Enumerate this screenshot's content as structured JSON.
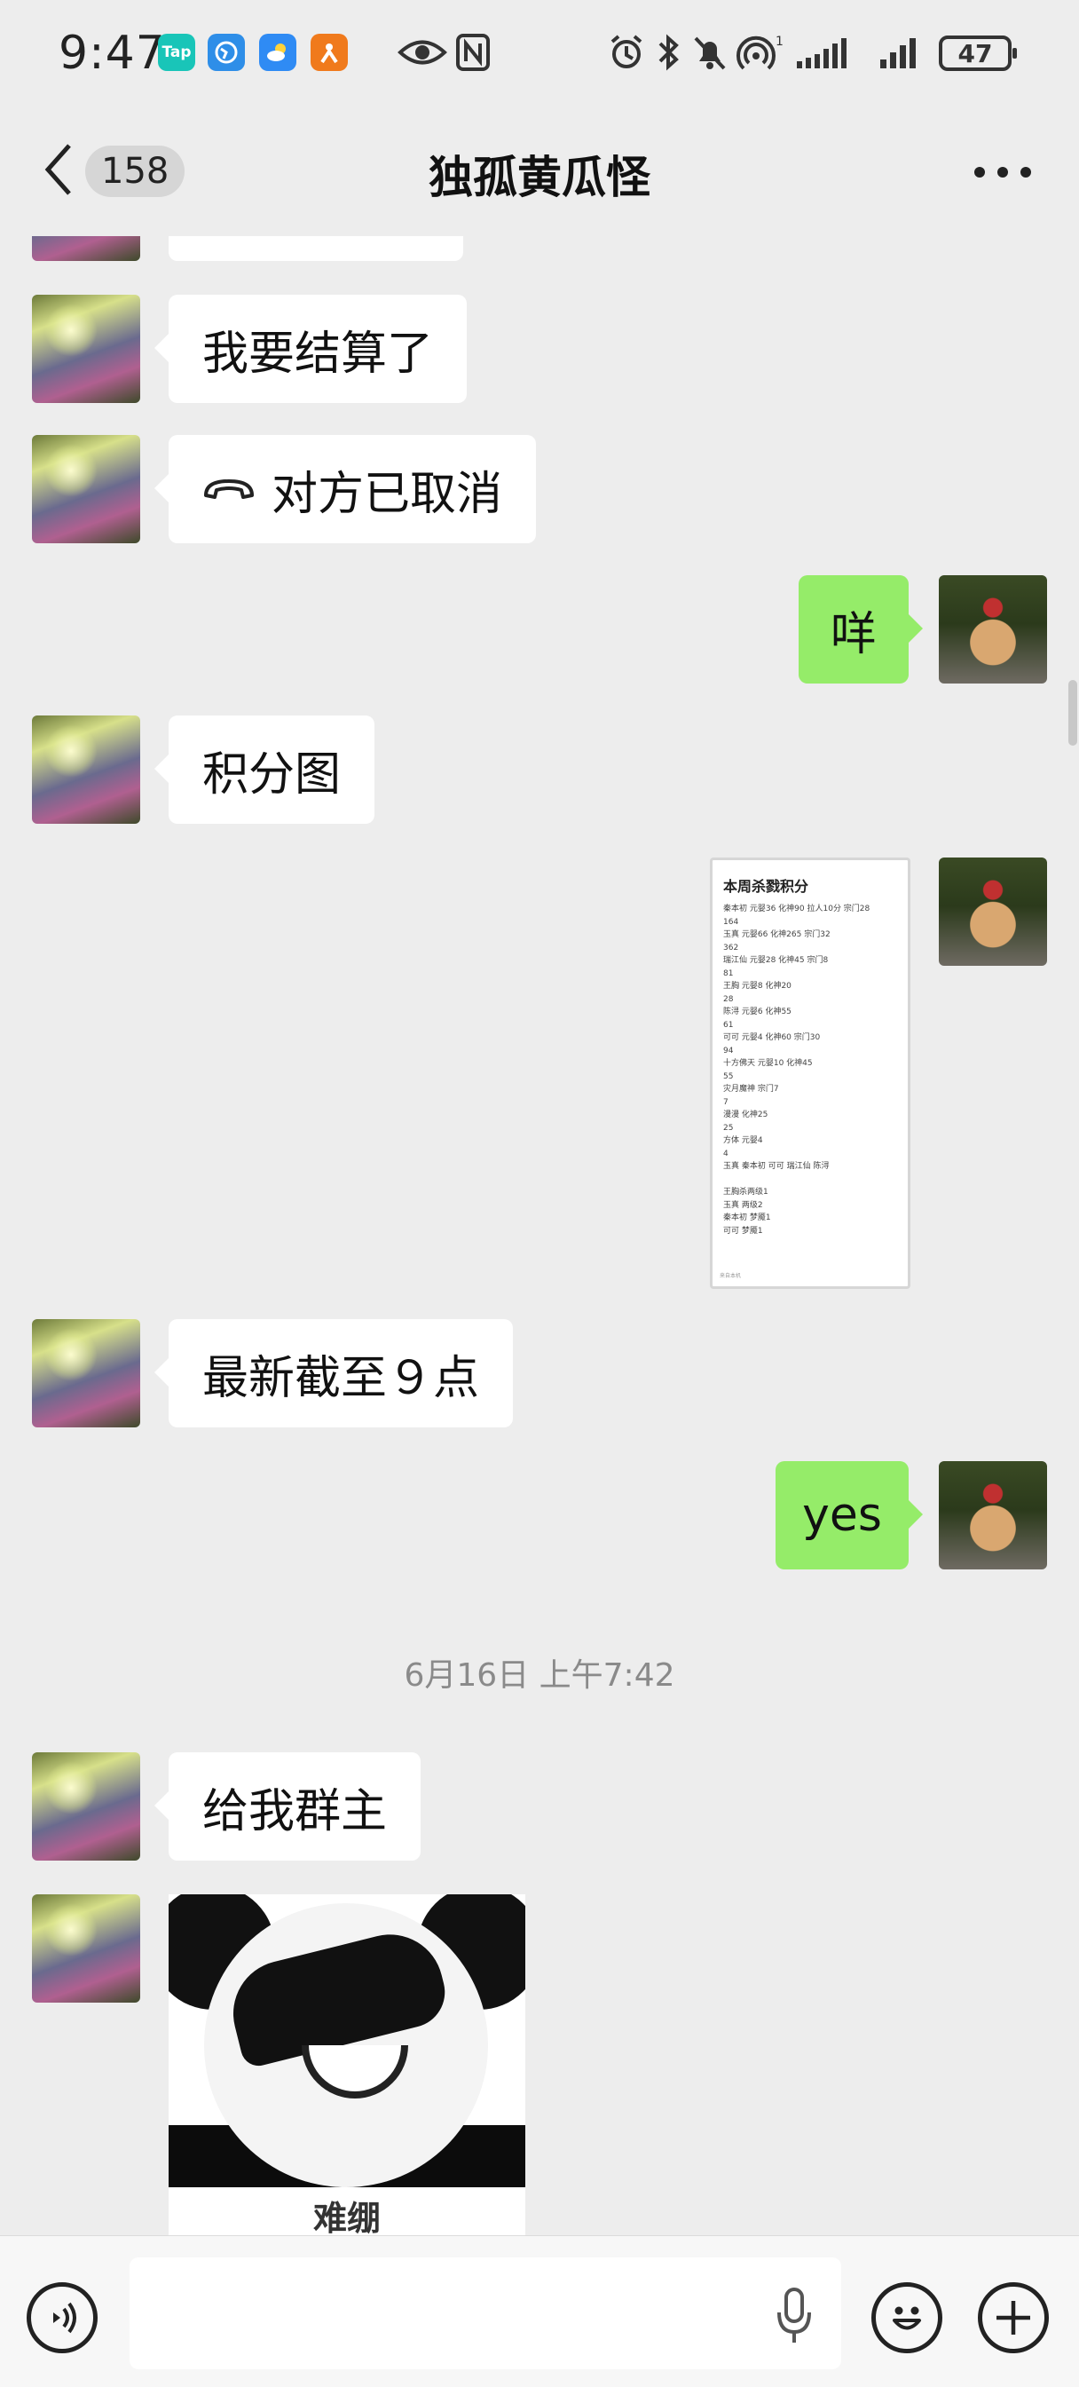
{
  "status_bar": {
    "time": "9:47",
    "apps": [
      {
        "name": "Tap",
        "color": "#19c5b8"
      },
      {
        "name": "",
        "color": "#2e8ee8"
      },
      {
        "name": "",
        "color": "#2f8bf4"
      },
      {
        "name": "",
        "color": "#f07a1c"
      }
    ],
    "battery": "47",
    "signal_sup": "1"
  },
  "nav": {
    "unread_count": "158",
    "title": "独孤黄瓜怪"
  },
  "messages": [
    {
      "side": "left",
      "text": ""
    },
    {
      "side": "left",
      "text": "我要结算了"
    },
    {
      "side": "left",
      "text": "对方已取消",
      "icon": "phone-hangup-icon"
    },
    {
      "side": "right",
      "text": "咩"
    },
    {
      "side": "left",
      "text": "积分图"
    },
    {
      "side": "right",
      "type": "image"
    },
    {
      "side": "left",
      "text": "最新截至９点"
    },
    {
      "side": "right",
      "text": "yes"
    },
    {
      "type": "timestamp",
      "text": "6月16日 上午7:42"
    },
    {
      "side": "left",
      "text": "给我群主"
    },
    {
      "side": "left",
      "type": "sticker",
      "caption": "难绷"
    }
  ],
  "score_image": {
    "title": "本周杀戮积分",
    "lines": [
      "秦本初 元婴36 化神90 拉人10分 宗门28",
      "164",
      "玉真 元婴66 化神265 宗门32",
      "362",
      "瑞江仙 元婴28 化神45 宗门8",
      "81",
      "王胸 元婴8 化神20",
      "28",
      "陈浔 元婴6 化神55",
      "61",
      "可可 元婴4 化神60 宗门30",
      "94",
      "十方佛天 元婴10 化神45",
      "55",
      "灾月魔神 宗门7",
      "7",
      "漫漫 化神25",
      "25",
      "方体 元婴4",
      "4",
      "玉真 秦本初 可可 瑞江仙 陈浔",
      "",
      "王胸杀两级1",
      "玉真 两级2",
      "秦本初 梦魇1",
      "可可 梦魇1"
    ],
    "footer": "来自本机"
  },
  "input_bar": {
    "placeholder": ""
  }
}
